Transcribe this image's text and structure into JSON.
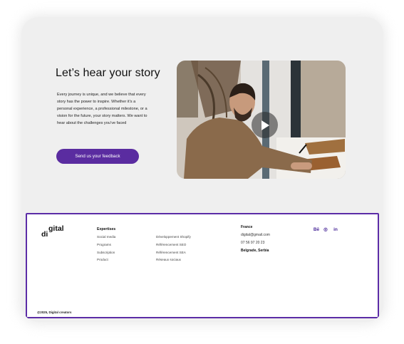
{
  "hero": {
    "title": "Let’s hear your story",
    "text": "Every journey is unique, and we believe that every story has the power to inspire. Whether it’s a personal experience, a professional milestone, or a vision for the future, your story matters. We want to hear about the challenges you’ve faced",
    "cta_label": "Send us your feedback"
  },
  "video": {
    "play_icon": "play-icon"
  },
  "footer": {
    "logo": {
      "part1": "di",
      "part2": "gital"
    },
    "expertises": {
      "title": "Expertises",
      "col1": [
        "Social media",
        "Programs",
        "Subscription",
        "Product"
      ],
      "col2": [
        "Développement Shopify",
        "Référencement SEO",
        "Référencement SEA",
        "Réseaux sociaux"
      ]
    },
    "contact": {
      "country": "France",
      "email": "digital@gmail.com",
      "phone": "07 56 97 20 23",
      "city": "Belgrade, Serbia"
    },
    "social": {
      "behance": "Bē",
      "dribbble": "◎",
      "linkedin": "in"
    },
    "copyright": "@2025, Digital creators"
  },
  "colors": {
    "accent": "#5a2ca0",
    "background": "#efefef"
  }
}
